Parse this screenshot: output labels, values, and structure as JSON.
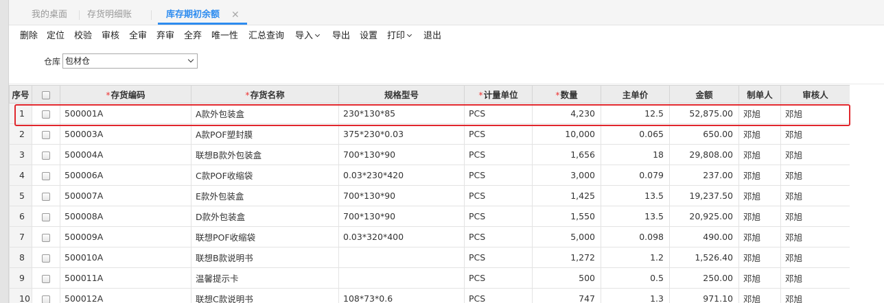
{
  "tabs": [
    {
      "label": "我的桌面"
    },
    {
      "label": "存货明细账"
    },
    {
      "label": "库存期初余额"
    }
  ],
  "tab_close_symbol": "✕",
  "toolbar": [
    {
      "label": "删除"
    },
    {
      "label": "定位"
    },
    {
      "label": "校验"
    },
    {
      "label": "审核"
    },
    {
      "label": "全审"
    },
    {
      "label": "弃审"
    },
    {
      "label": "全弃"
    },
    {
      "label": "唯一性"
    },
    {
      "label": "汇总查询"
    },
    {
      "label": "导入"
    },
    {
      "label": "导出"
    },
    {
      "label": "设置"
    },
    {
      "label": "打印"
    },
    {
      "label": "退出"
    }
  ],
  "filter": {
    "warehouse_label": "仓库",
    "warehouse_value": "包材仓"
  },
  "required_mark": "*",
  "columns": {
    "seq": "序号",
    "code": "存货编码",
    "name": "存货名称",
    "spec": "规格型号",
    "unit": "计量单位",
    "qty": "数量",
    "price": "主单价",
    "amount": "金额",
    "maker": "制单人",
    "auditor": "审核人"
  },
  "rows": [
    {
      "seq": "1",
      "code": "500001A",
      "name": "A款外包装盒",
      "spec": "230*130*85",
      "unit": "PCS",
      "qty": "4,230",
      "price": "12.5",
      "amount": "52,875.00",
      "maker": "邓旭",
      "auditor": "邓旭"
    },
    {
      "seq": "2",
      "code": "500003A",
      "name": "A款POF塑封膜",
      "spec": "375*230*0.03",
      "unit": "PCS",
      "qty": "10,000",
      "price": "0.065",
      "amount": "650.00",
      "maker": "邓旭",
      "auditor": "邓旭"
    },
    {
      "seq": "3",
      "code": "500004A",
      "name": "联想B款外包装盒",
      "spec": "700*130*90",
      "unit": "PCS",
      "qty": "1,656",
      "price": "18",
      "amount": "29,808.00",
      "maker": "邓旭",
      "auditor": "邓旭"
    },
    {
      "seq": "4",
      "code": "500006A",
      "name": "C款POF收缩袋",
      "spec": "0.03*230*420",
      "unit": "PCS",
      "qty": "3,000",
      "price": "0.079",
      "amount": "237.00",
      "maker": "邓旭",
      "auditor": "邓旭"
    },
    {
      "seq": "5",
      "code": "500007A",
      "name": "E款外包装盒",
      "spec": "700*130*90",
      "unit": "PCS",
      "qty": "1,425",
      "price": "13.5",
      "amount": "19,237.50",
      "maker": "邓旭",
      "auditor": "邓旭"
    },
    {
      "seq": "6",
      "code": "500008A",
      "name": "D款外包装盒",
      "spec": "700*130*90",
      "unit": "PCS",
      "qty": "1,550",
      "price": "13.5",
      "amount": "20,925.00",
      "maker": "邓旭",
      "auditor": "邓旭"
    },
    {
      "seq": "7",
      "code": "500009A",
      "name": "联想POF收缩袋",
      "spec": "0.03*320*400",
      "unit": "PCS",
      "qty": "5,000",
      "price": "0.098",
      "amount": "490.00",
      "maker": "邓旭",
      "auditor": "邓旭"
    },
    {
      "seq": "8",
      "code": "500010A",
      "name": "联想B款说明书",
      "spec": "",
      "unit": "PCS",
      "qty": "1,272",
      "price": "1.2",
      "amount": "1,526.40",
      "maker": "邓旭",
      "auditor": "邓旭"
    },
    {
      "seq": "9",
      "code": "500011A",
      "name": "温馨提示卡",
      "spec": "",
      "unit": "PCS",
      "qty": "500",
      "price": "0.5",
      "amount": "250.00",
      "maker": "邓旭",
      "auditor": "邓旭"
    },
    {
      "seq": "10",
      "code": "500012A",
      "name": "联想C款说明书",
      "spec": "108*73*0.6",
      "unit": "PCS",
      "qty": "747",
      "price": "1.3",
      "amount": "971.10",
      "maker": "邓旭",
      "auditor": "邓旭"
    }
  ],
  "colors": {
    "accent": "#2d8cf0",
    "highlight": "#e0262c",
    "required": "#e33333"
  }
}
